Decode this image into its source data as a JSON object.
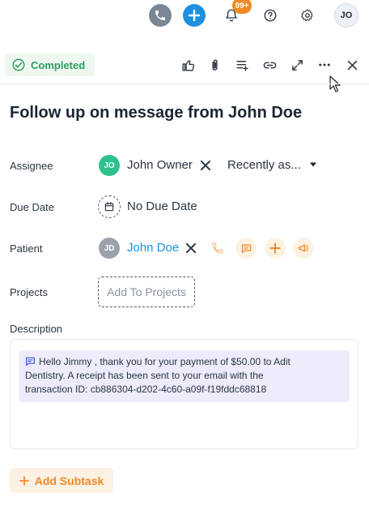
{
  "topbar": {
    "notification_count": "99+",
    "user_initials": "JO"
  },
  "task": {
    "status": "Completed",
    "title": "Follow up on message from John Doe"
  },
  "fields": {
    "assignee_label": "Assignee",
    "assignee_initials": "JO",
    "assignee_name": "John Owner",
    "assignee_sort": "Recently as...",
    "due_label": "Due Date",
    "due_value": "No Due Date",
    "patient_label": "Patient",
    "patient_initials": "JD",
    "patient_name": "John Doe",
    "projects_label": "Projects",
    "projects_placeholder": "Add To Projects",
    "description_label": "Description"
  },
  "description": {
    "line1": "Hello Jimmy , thank you for your payment of $50.00 to Adit",
    "line2": "Dentistry. A receipt has been sent to your email with the",
    "line3": "transaction ID: cb886304-d202-4c60-a09f-f19fddc68818"
  },
  "footer": {
    "add_subtask_label": "Add Subtask"
  },
  "colors": {
    "accent_orange": "#f08a24",
    "success_green": "#2f9e5f",
    "primary_blue": "#1e8fe0",
    "link_blue": "#1e8fe0"
  }
}
